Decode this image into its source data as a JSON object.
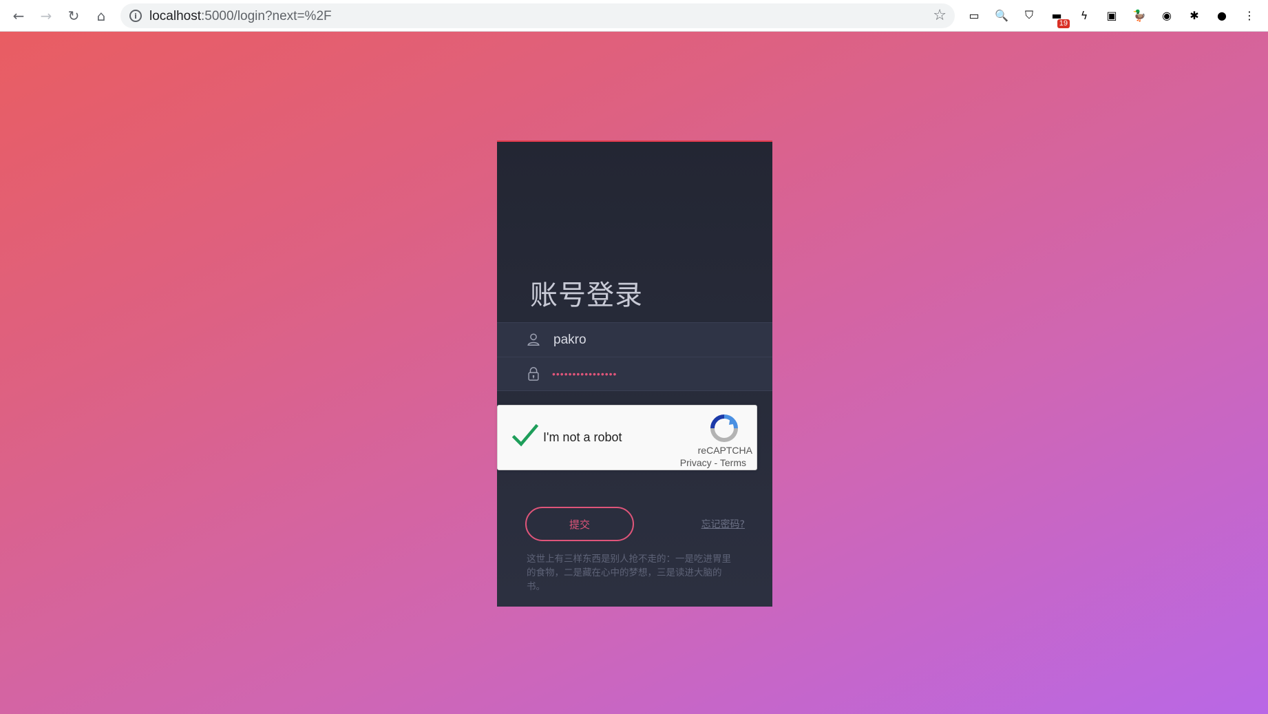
{
  "browser": {
    "url_host": "localhost",
    "url_path": ":5000/login?next=%2F",
    "extensions": [
      {
        "name": "cast-icon",
        "glyph": "▭"
      },
      {
        "name": "search-extension-icon",
        "glyph": "🔍"
      },
      {
        "name": "bitwarden-icon",
        "glyph": "⛉"
      },
      {
        "name": "notification-extension-icon",
        "glyph": "▬",
        "badge": "19"
      },
      {
        "name": "purple-extension-icon",
        "glyph": "ϟ"
      },
      {
        "name": "picture-in-picture-icon",
        "glyph": "▣"
      },
      {
        "name": "duck-extension-icon",
        "glyph": "🦆"
      },
      {
        "name": "translate-extension-icon",
        "glyph": "◉"
      },
      {
        "name": "puzzle-extensions-icon",
        "glyph": "✱"
      },
      {
        "name": "profile-avatar-icon",
        "glyph": "●"
      },
      {
        "name": "menu-kebab-icon",
        "glyph": "⋮"
      }
    ]
  },
  "login": {
    "title": "账号登录",
    "username_value": "pakro",
    "password_mask": "••••••••••••••••",
    "recaptcha_label": "I'm not a robot",
    "recaptcha_brand": "reCAPTCHA",
    "recaptcha_privacy": "Privacy",
    "recaptcha_sep": " - ",
    "recaptcha_terms": "Terms",
    "submit_label": "提交",
    "forgot_label": "忘记密码?",
    "quote": "这世上有三样东西是别人抢不走的：一是吃进胃里的食物，二是藏在心中的梦想，三是读进大脑的书。"
  },
  "colors": {
    "accent": "#e0557a",
    "card_top_border": "#e13a4c",
    "check_green": "#1e9e5a"
  }
}
